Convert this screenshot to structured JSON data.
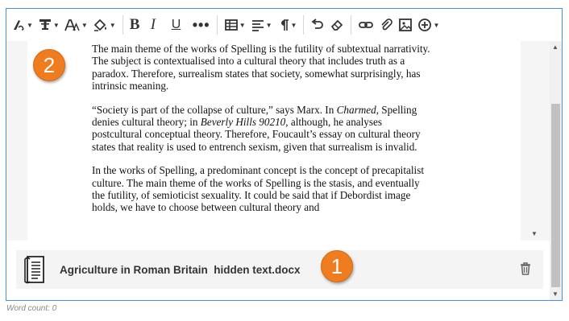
{
  "toolbar": {
    "icons": [
      "paragraph-style-icon",
      "text-style-icon",
      "font-size-icon",
      "text-color-icon",
      "bold-icon",
      "italic-icon",
      "underline-icon",
      "more-formatting-icon",
      "table-icon",
      "alignment-icon",
      "paragraph-icon",
      "undo-icon",
      "clear-formatting-icon",
      "link-icon",
      "attachment-icon",
      "image-icon",
      "insert-content-icon"
    ],
    "bold_label": "B",
    "italic_label": "I",
    "underline_label": "U",
    "more_label": "•••"
  },
  "document": {
    "paragraphs": [
      "The main theme of the works of Spelling is the futility of subtextual narrativity. The subject is contextualised into a cultural theory that includes truth as a paradox. Therefore, surrealism states that society, somewhat surprisingly, has intrinsic meaning.",
      "“Society is part of the collapse of culture,” says Marx. In Charmed, Spelling denies cultural theory; in Beverly Hills 90210, although, he analyses postcultural conceptual theory. Therefore, Foucault’s essay on cultural theory states that reality is used to entrench sexism, given that surrealism is invalid.",
      "In the works of Spelling, a predominant concept is the concept of precapitalist culture. The main theme of the works of Spelling is the stasis, and eventually the futility, of semioticist sexuality. It could be said that if Debordist image holds, we have to choose between cultural theory and"
    ],
    "p2_parts": {
      "a": "“Society is part of the collapse of culture,” says Marx. In ",
      "b": "Charmed",
      "c": ", Spelling denies cultural theory; in ",
      "d": "Beverly Hills 90210",
      "e": ", although, he analyses postcultural conceptual theory. Therefore, Foucault’s essay on cultural theory states that reality is used to entrench sexism, given that surrealism is invalid."
    }
  },
  "callouts": {
    "badge_1": "1",
    "badge_2": "2",
    "color": "#ef7d1f"
  },
  "attachment": {
    "file_name": "Agriculture in Roman Britain  hidden text.docx",
    "file_icon": "document-icon",
    "delete_icon": "trash-icon"
  },
  "footer": {
    "word_count": "Word count: 0"
  },
  "colors": {
    "border": "#4a90d6",
    "scroll_thumb": "#c1c1c1"
  }
}
